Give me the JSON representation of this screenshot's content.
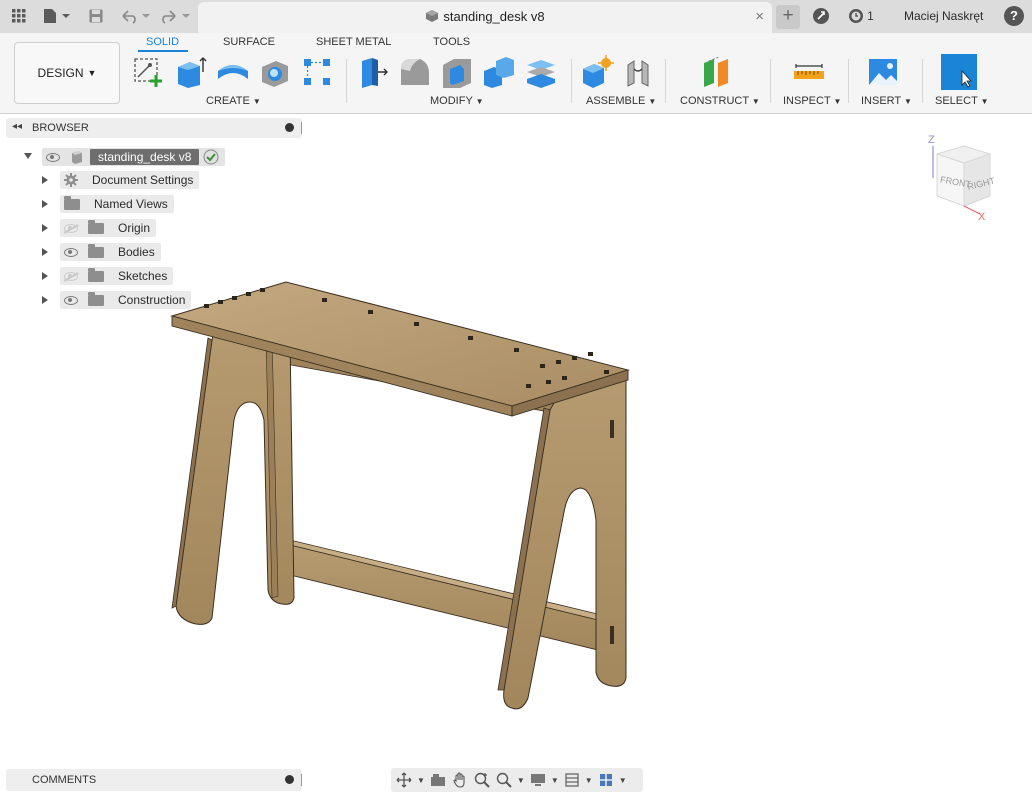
{
  "window": {
    "doc_title": "standing_desk v8",
    "close_glyph": "×",
    "user_name": "Maciej Naskręt",
    "jobs_count": "1",
    "help_glyph": "?"
  },
  "toolbar": {
    "workspace_label": "DESIGN",
    "tabs": [
      "SOLID",
      "SURFACE",
      "SHEET METAL",
      "TOOLS"
    ],
    "groups": [
      "CREATE",
      "MODIFY",
      "ASSEMBLE",
      "CONSTRUCT",
      "INSPECT",
      "INSERT",
      "SELECT"
    ]
  },
  "browser": {
    "header": "BROWSER",
    "root": "standing_desk v8",
    "items": [
      "Document Settings",
      "Named Views",
      "Origin",
      "Bodies",
      "Sketches",
      "Construction"
    ]
  },
  "viewcube": {
    "face_front": "FRONT",
    "face_right": "RIGHT",
    "axis_z": "Z",
    "axis_x": "X"
  },
  "comments": {
    "label": "COMMENTS"
  },
  "colors": {
    "accent": "#1a84d6",
    "wood": "#b59a72"
  }
}
